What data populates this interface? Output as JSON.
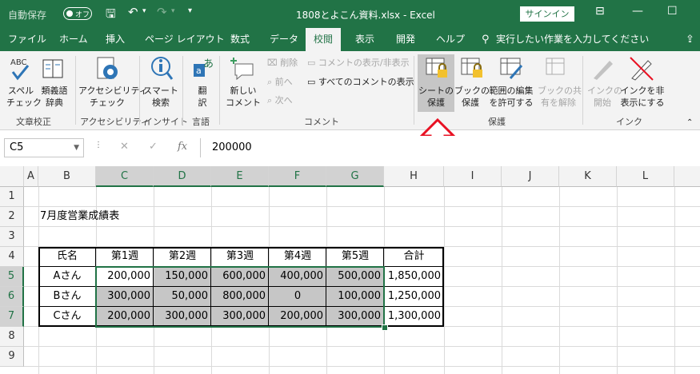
{
  "title_bar": {
    "autosave_label": "自動保存",
    "autosave_state": "オフ",
    "file_title": "1808とよこん資料.xlsx  -  Excel",
    "signin_label": "サインイン"
  },
  "tabs": [
    "ファイル",
    "ホーム",
    "挿入",
    "ページ レイアウト",
    "数式",
    "データ",
    "校閲",
    "表示",
    "開発",
    "ヘルプ"
  ],
  "active_tab": "校閲",
  "tell_me_placeholder": "実行したい作業を入力してください",
  "ribbon": {
    "spell_check": [
      "スペル",
      "チェック"
    ],
    "thesaurus": [
      "類義語",
      "辞典"
    ],
    "group_proofing": "文章校正",
    "accessibility": [
      "アクセシビリティ",
      "チェック"
    ],
    "group_accessibility": "アクセシビリティ",
    "smart_lookup": [
      "スマート",
      "検索"
    ],
    "group_insights": "インサイト",
    "translate": [
      "翻",
      "訳"
    ],
    "group_language": "言語",
    "new_comment": [
      "新しい",
      "コメント"
    ],
    "delete": "削除",
    "previous": "前へ",
    "next": "次へ",
    "show_hide_comment": "コメントの表示/非表示",
    "show_all_comments": "すべてのコメントの表示",
    "group_comments": "コメント",
    "protect_sheet": [
      "シートの",
      "保護"
    ],
    "protect_book": [
      "ブックの",
      "保護"
    ],
    "allow_edit_ranges": [
      "範囲の編集",
      "を許可する"
    ],
    "unshare_book": [
      "ブックの共",
      "有を解除"
    ],
    "group_protect": "保護",
    "start_ink": [
      "インクの",
      "開始"
    ],
    "hide_ink": [
      "インクを非",
      "表示にする"
    ],
    "group_ink": "インク"
  },
  "formula_bar": {
    "name_box": "C5",
    "formula_value": "200000",
    "fx": "fx"
  },
  "columns": [
    "A",
    "B",
    "C",
    "D",
    "E",
    "F",
    "G",
    "H",
    "I",
    "J",
    "K",
    "L"
  ],
  "rows": [
    "1",
    "2",
    "3",
    "4",
    "5",
    "6",
    "7",
    "8",
    "9"
  ],
  "sheet": {
    "title": "7月度営業成績表",
    "headers": [
      "氏名",
      "第1週",
      "第2週",
      "第3週",
      "第4週",
      "第5週",
      "合計"
    ],
    "data": [
      [
        "Aさん",
        "200,000",
        "150,000",
        "600,000",
        "400,000",
        "500,000",
        "1,850,000"
      ],
      [
        "Bさん",
        "300,000",
        "50,000",
        "800,000",
        "0",
        "100,000",
        "1,250,000"
      ],
      [
        "Cさん",
        "200,000",
        "300,000",
        "300,000",
        "200,000",
        "300,000",
        "1,300,000"
      ]
    ]
  },
  "colors": {
    "excel_green": "#217346",
    "arrow_red": "#e81123",
    "selection_gray": "#c6c6c6"
  }
}
